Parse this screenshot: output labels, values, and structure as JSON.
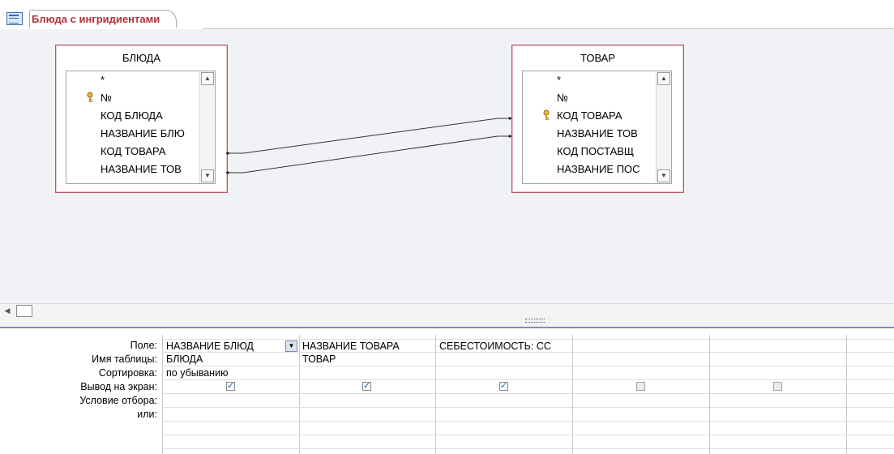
{
  "tab": {
    "label": "Блюда с ингридиентами",
    "icon": "query-icon"
  },
  "tables": [
    {
      "title": "БЛЮДА",
      "fields": [
        "*",
        "№",
        "КОД БЛЮДА",
        "НАЗВАНИЕ БЛЮ",
        "КОД ТОВАРА",
        "НАЗВАНИЕ ТОВ"
      ],
      "key_field": "№"
    },
    {
      "title": "ТОВАР",
      "fields": [
        "*",
        "№",
        "КОД ТОВАРА",
        "НАЗВАНИЕ ТОВ",
        "КОД ПОСТАВЩ",
        "НАЗВАНИЕ ПОС"
      ],
      "key_field": "КОД ТОВАРА"
    }
  ],
  "grid": {
    "row_labels": [
      "Поле:",
      "Имя таблицы:",
      "Сортировка:",
      "Вывод на экран:",
      "Условие отбора:",
      "или:"
    ],
    "columns": [
      {
        "field": "НАЗВАНИЕ БЛЮД",
        "table": "БЛЮДА",
        "sort": "по убыванию",
        "show": true
      },
      {
        "field": "НАЗВАНИЕ ТОВАРА",
        "table": "ТОВАР",
        "sort": "",
        "show": true
      },
      {
        "field": "СЕБЕСТОИМОСТЬ: СС",
        "table": "",
        "sort": "",
        "show": true
      },
      {
        "field": "",
        "table": "",
        "sort": "",
        "show": false
      },
      {
        "field": "",
        "table": "",
        "sort": "",
        "show": false
      },
      {
        "field": "",
        "table": "",
        "sort": "",
        "show": false
      }
    ]
  },
  "colors": {
    "accent": "#b0323a",
    "table_border": "#b9585f",
    "design_bg": "#f1f2f6"
  }
}
